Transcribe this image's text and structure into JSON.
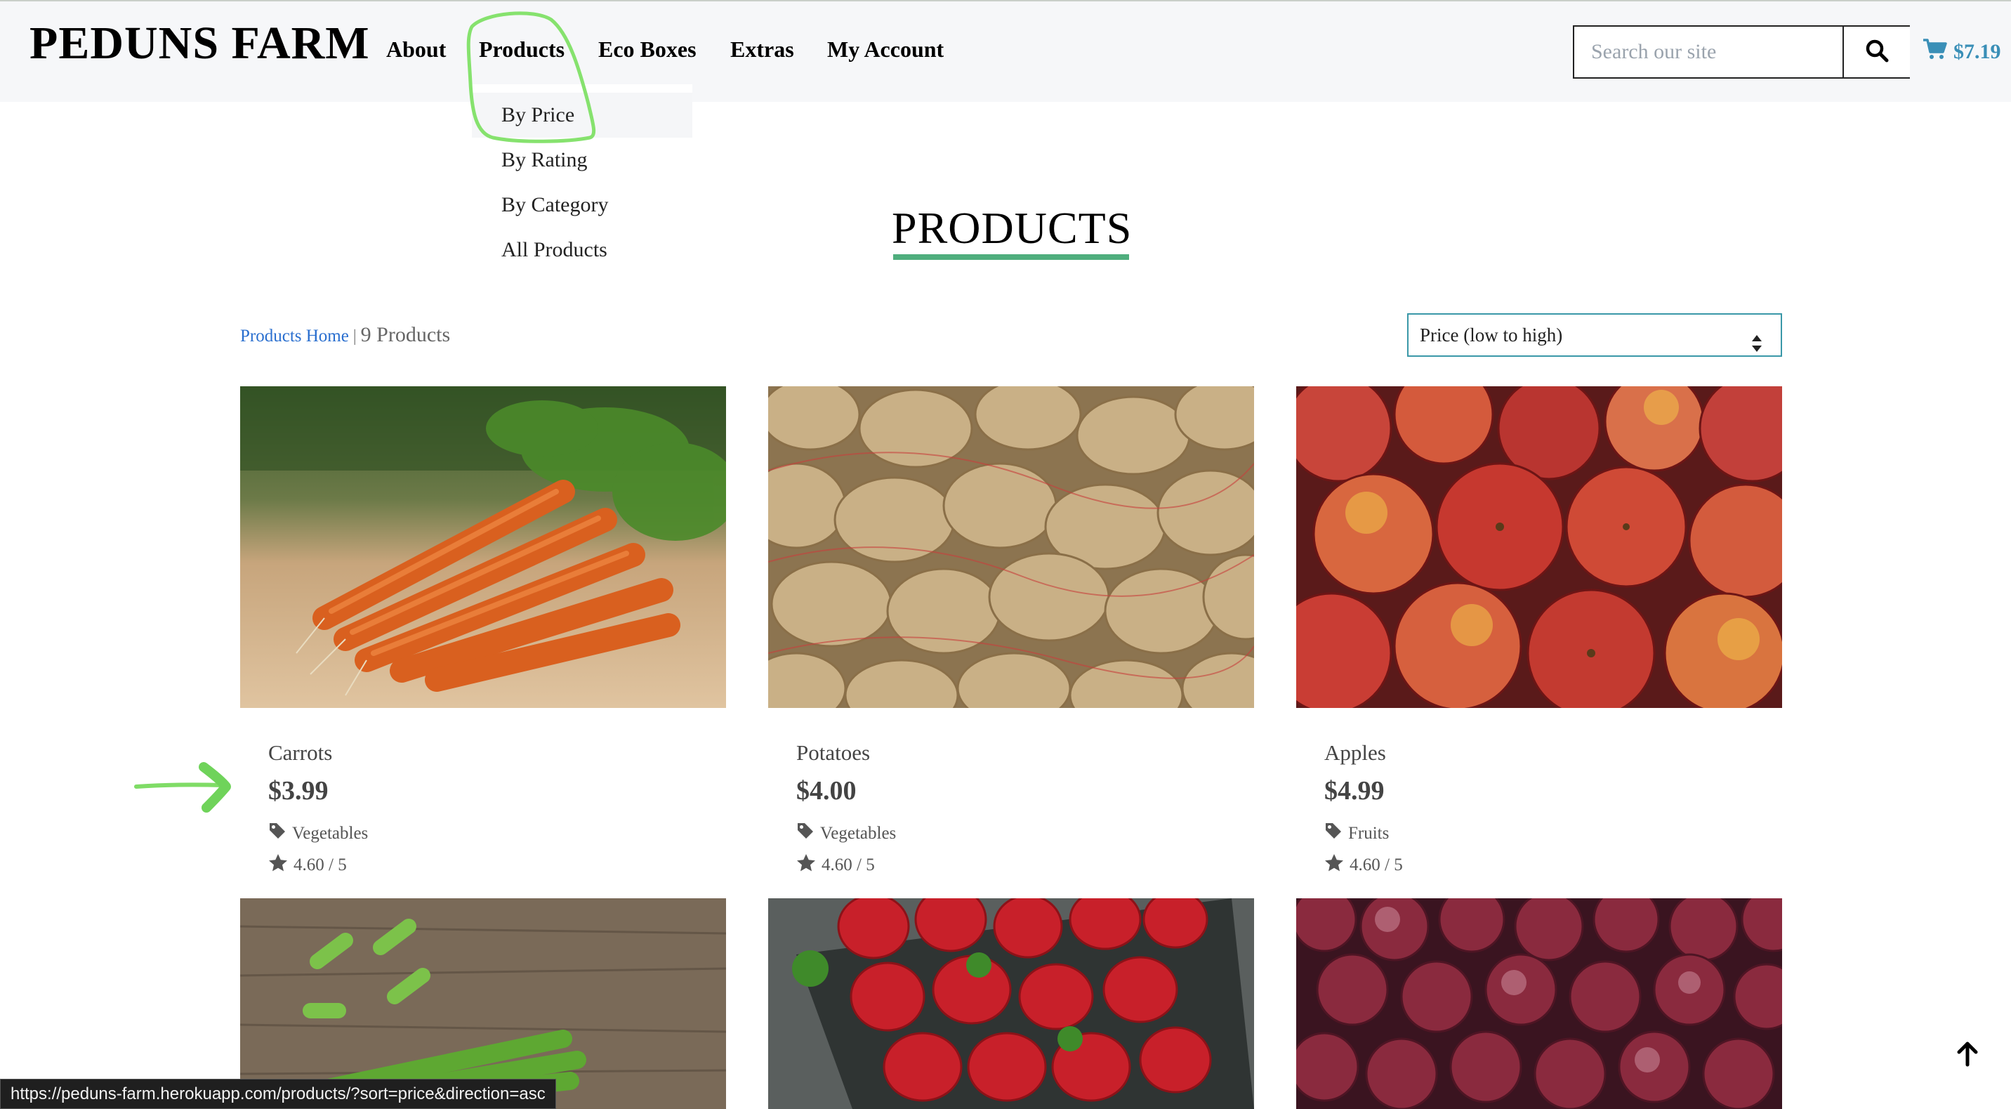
{
  "header": {
    "brand": "PEDUNS FARM",
    "nav": [
      {
        "label": "About"
      },
      {
        "label": "Products"
      },
      {
        "label": "Eco Boxes"
      },
      {
        "label": "Extras"
      },
      {
        "label": "My Account"
      }
    ],
    "search": {
      "placeholder": "Search our site",
      "value": ""
    },
    "cart_total": "$7.19"
  },
  "dropdown": {
    "items": [
      {
        "label": "By Price"
      },
      {
        "label": "By Rating"
      },
      {
        "label": "By Category"
      },
      {
        "label": "All Products"
      }
    ]
  },
  "page": {
    "title": "PRODUCTS",
    "breadcrumb_link": "Products Home",
    "breadcrumb_sep": "|",
    "product_count": "9 Products",
    "sort_selected": "Price (low to high)"
  },
  "products": [
    {
      "name": "Carrots",
      "price": "$3.99",
      "category": "Vegetables",
      "rating": "4.60 / 5"
    },
    {
      "name": "Potatoes",
      "price": "$4.00",
      "category": "Vegetables",
      "rating": "4.60 / 5"
    },
    {
      "name": "Apples",
      "price": "$4.99",
      "category": "Fruits",
      "rating": "4.60 / 5"
    }
  ],
  "status_bar": {
    "url": "https://peduns-farm.herokuapp.com/products/?sort=price&direction=asc"
  },
  "colors": {
    "accent_green": "#4fae7d",
    "cart_blue": "#3a8fb7",
    "link_blue": "#2a6fcf",
    "annotation_green": "#7ee06a"
  },
  "icons": [
    "search-icon",
    "cart-icon",
    "tag-icon",
    "star-icon",
    "sort-arrows-icon",
    "arrow-up-icon"
  ]
}
